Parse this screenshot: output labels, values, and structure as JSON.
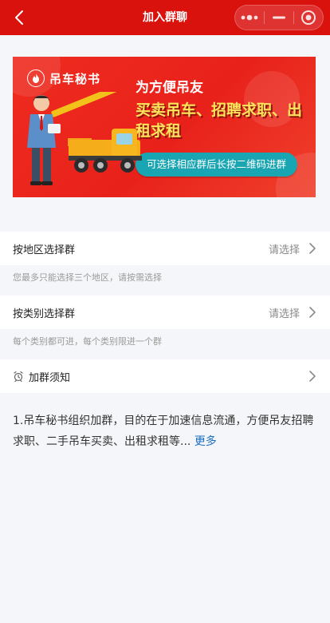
{
  "header": {
    "title": "加入群聊",
    "back_icon": "chevron-left-icon",
    "menu_icon": "more-dots-icon",
    "minimize_icon": "minimize-icon",
    "close_icon": "target-close-icon",
    "background": "#d9120e"
  },
  "banner": {
    "brand": "吊车秘书",
    "headline": "为方便吊友",
    "slogan": "买卖吊车、招聘求职、出租求租",
    "cta": "可选择相应群后长按二维码进群",
    "colors": {
      "primary": "#e8221b",
      "slogan": "#ffe45c",
      "cta": "#1aa5b2"
    }
  },
  "filters": [
    {
      "label": "按地区选择群",
      "value": "请选择",
      "hint": "您最多只能选择三个地区，请按需选择"
    },
    {
      "label": "按类别选择群",
      "value": "请选择",
      "hint": "每个类别都可进，每个类别限进一个群"
    }
  ],
  "notice": {
    "title": "加群须知",
    "icon": "alarm-clock-icon",
    "text": "1.吊车秘书组织加群，目的在于加速信息流通，方便吊友招聘求职、二手吊车买卖、出租求租等...",
    "more": "更多",
    "link_color": "#1b6ec2"
  }
}
